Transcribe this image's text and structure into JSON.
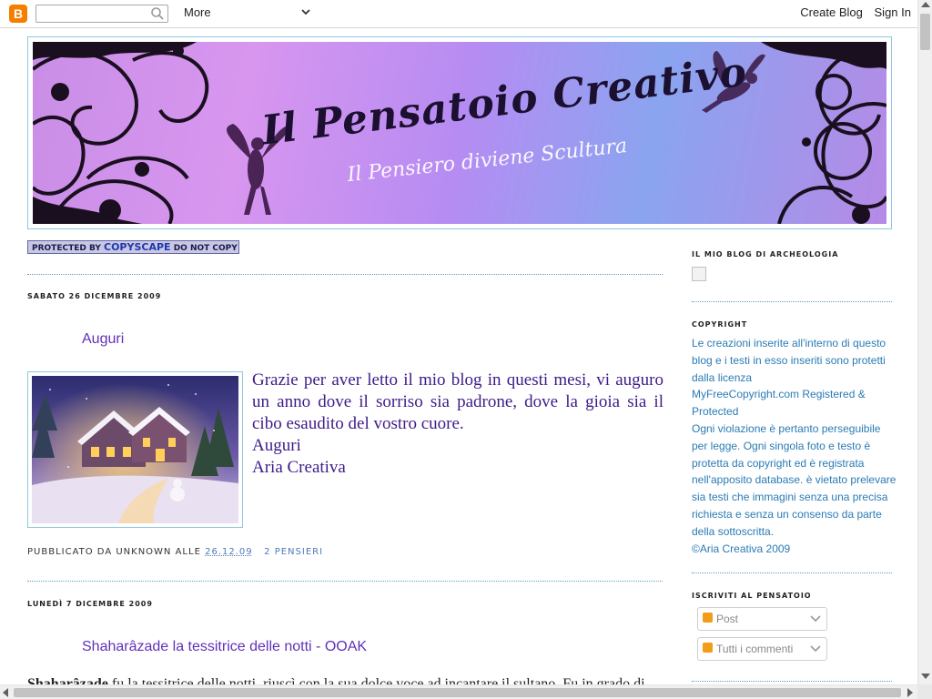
{
  "navbar": {
    "more_label": "More",
    "create_blog": "Create Blog",
    "sign_in": "Sign In"
  },
  "header": {
    "title": "Il Pensatoio Creativo",
    "subtitle": "Il Pensiero diviene Scultura"
  },
  "copyscape": {
    "prefix": "PROTECTED BY",
    "brand": "COPYSCAPE",
    "suffix": "DO NOT COPY"
  },
  "posts": [
    {
      "date": "SABATO 26 DICEMBRE 2009",
      "title": "Auguri",
      "body": "Grazie per aver letto il mio blog in questi mesi, vi auguro un anno dove il sorriso sia padrone, dove la gioia sia il cibo esaudito del vostro cuore.",
      "greeting": "Auguri",
      "signature": "Aria Creativa",
      "footer_label": "PUBBLICATO DA UNKNOWN ALLE",
      "time": "26.12.09",
      "comments": "2 PENSIERI"
    },
    {
      "date": "LUNEDÌ 7 DICEMBRE 2009",
      "title": "Shaharâzade la tessitrice delle notti - OOAK",
      "body_bold": "Shaharâzade",
      "body": "fu la tessitrice delle notti, riuscì con la sua dolce voce ad incantare il sultano. Fu in grado di"
    }
  ],
  "sidebar": {
    "archeo_heading": "IL MIO BLOG DI ARCHEOLOGIA",
    "copyright_heading": "COPYRIGHT",
    "copyright_text": "Le creazioni inserite all'interno di questo blog e i testi in esso inseriti sono protetti dalla licenza",
    "copyright_img_alt": "MyFreeCopyright.com Registered & Protected",
    "copyright_text2": "Ogni violazione è pertanto perseguibile per legge. Ogni singola foto e testo è protetta da copyright ed è registrata nell'apposito database. è vietato prelevare sia testi che immagini senza una precisa richiesta e senza un consenso da parte della sottoscritta.",
    "copyright_owner": "©Aria Creativa 2009",
    "subscribe_heading": "ISCRIVITI AL PENSATOIO",
    "subscribe_post": "Post",
    "subscribe_comments": "Tutti i commenti"
  },
  "colors": {
    "accent_link": "#2a7bb5",
    "post_title": "#6031b8",
    "post_text": "#3d1b88",
    "border": "#8ec7e0"
  }
}
